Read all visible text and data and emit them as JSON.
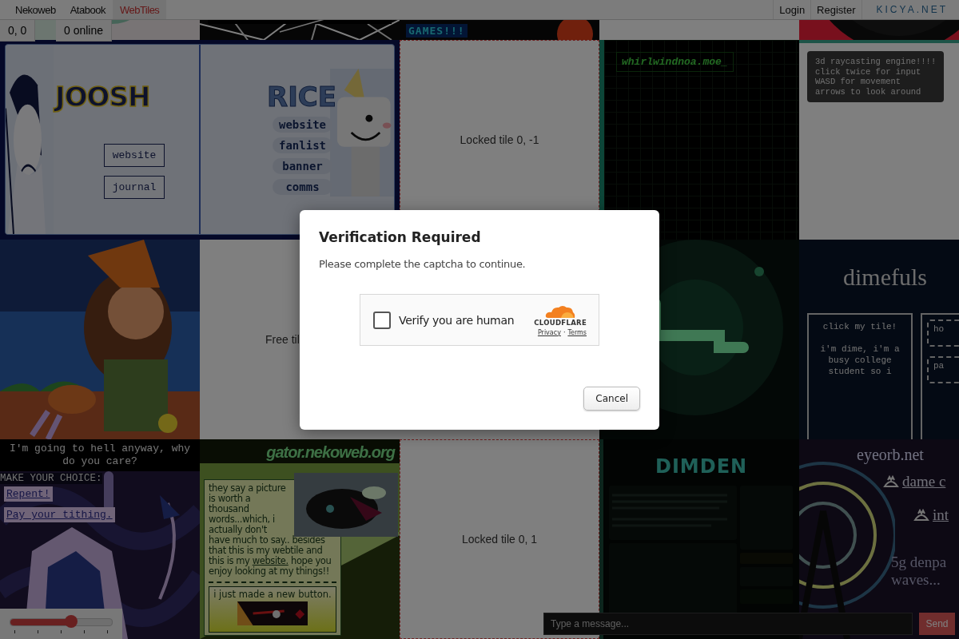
{
  "nav": {
    "links": [
      {
        "label": "Nekoweb",
        "selected": false
      },
      {
        "label": "Atabook",
        "selected": false
      },
      {
        "label": "WebTiles",
        "selected": true
      }
    ],
    "account": [
      "Login",
      "Register"
    ],
    "brand": "KICYA.NET"
  },
  "status": {
    "coords": "0, 0",
    "online": "0 online"
  },
  "tiles": [
    {
      "kind": "picture"
    },
    {
      "kind": "picture"
    },
    {
      "kind": "games",
      "label": "GAMES!!!"
    },
    {
      "kind": "blank"
    },
    {
      "kind": "picture"
    },
    {
      "kind": "duo",
      "left": {
        "title": "JOOSH",
        "links": [
          "website",
          "journal"
        ]
      },
      "right": {
        "title": "RICE",
        "links": [
          "website",
          "fanlist",
          "banner",
          "comms"
        ]
      }
    },
    {
      "kind": "locked",
      "text": "Locked tile 0, -1"
    },
    {
      "kind": "terminal",
      "text": "whirlwindnoa.moe_"
    },
    {
      "kind": "note",
      "lines": [
        "3d raycasting engine!!!!",
        "click twice for input",
        "WASD for movement",
        "arrows to look around"
      ]
    },
    {
      "kind": "picture"
    },
    {
      "kind": "free",
      "text": "Free til"
    },
    {
      "kind": "blank"
    },
    {
      "kind": "picture"
    },
    {
      "kind": "dime",
      "title": "dimefuls",
      "lines": [
        "click my tile!",
        "i'm dime, i'm a",
        "busy college",
        "student so i"
      ],
      "side": [
        "ho",
        "pa"
      ]
    },
    {
      "kind": "choice",
      "quote": "I'm going to hell anyway, why do you care?",
      "prompt": "MAKE YOUR CHOICE:",
      "options": [
        "Repent!",
        "Pay your tithing."
      ]
    },
    {
      "kind": "gator",
      "site": "gator.nekoweb.org",
      "before": "they say a picture is worth a thousand words...which, i actually don't have much to say.. besides that this is my webtile and this is my",
      "link": "website.",
      "after": "hope you enjoy looking at my things!!",
      "caption": "i just made a new button."
    },
    {
      "kind": "locked",
      "text": "Locked tile 0, 1"
    },
    {
      "kind": "dimden",
      "title": "DIMDEN"
    },
    {
      "kind": "eyeorb",
      "site": "eyeorb.net",
      "links": [
        "dame c",
        "int"
      ],
      "caption": [
        "5g denpa",
        "waves..."
      ]
    }
  ],
  "volume": {
    "level": 0.6
  },
  "chat": {
    "placeholder": "Type a message...",
    "button": "Send"
  },
  "modal": {
    "title": "Verification Required",
    "message": "Please complete the captcha to continue.",
    "captcha": {
      "checked": false,
      "label": "Verify you are human",
      "brand": "CLOUDFLARE",
      "links": [
        "Privacy",
        "Terms"
      ],
      "separator": "·"
    },
    "button": "Cancel"
  }
}
